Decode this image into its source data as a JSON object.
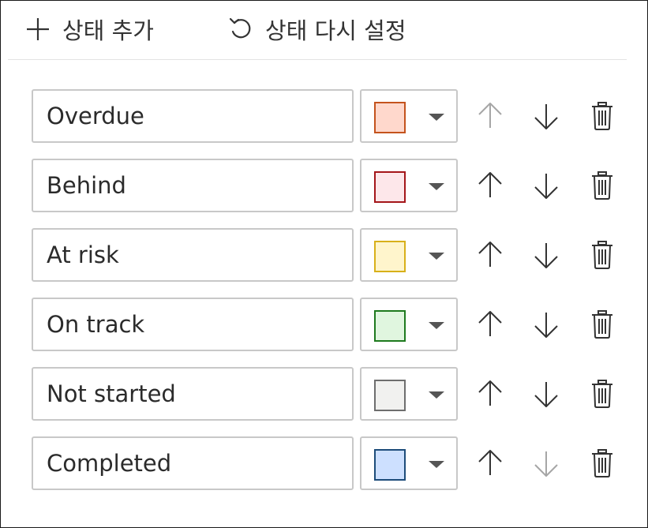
{
  "toolbar": {
    "add_label": "상태 추가",
    "reset_label": "상태 다시 설정"
  },
  "colors": {
    "icon_enabled": "#333333",
    "icon_disabled": "#a6a6a6",
    "input_border": "#c8c8c8"
  },
  "statuses": [
    {
      "label": "Overdue",
      "fill": "#ffd8cc",
      "border": "#c4531d",
      "up_enabled": false,
      "down_enabled": true
    },
    {
      "label": "Behind",
      "fill": "#fde7ea",
      "border": "#a4161a",
      "up_enabled": true,
      "down_enabled": true
    },
    {
      "label": "At risk",
      "fill": "#fff5cc",
      "border": "#d8b01a",
      "up_enabled": true,
      "down_enabled": true
    },
    {
      "label": "On track",
      "fill": "#e0f6df",
      "border": "#1e7a1e",
      "up_enabled": true,
      "down_enabled": true
    },
    {
      "label": "Not started",
      "fill": "#f1f1ef",
      "border": "#6e6e6e",
      "up_enabled": true,
      "down_enabled": true
    },
    {
      "label": "Completed",
      "fill": "#cde0ff",
      "border": "#1d4c7a",
      "up_enabled": true,
      "down_enabled": false
    }
  ]
}
